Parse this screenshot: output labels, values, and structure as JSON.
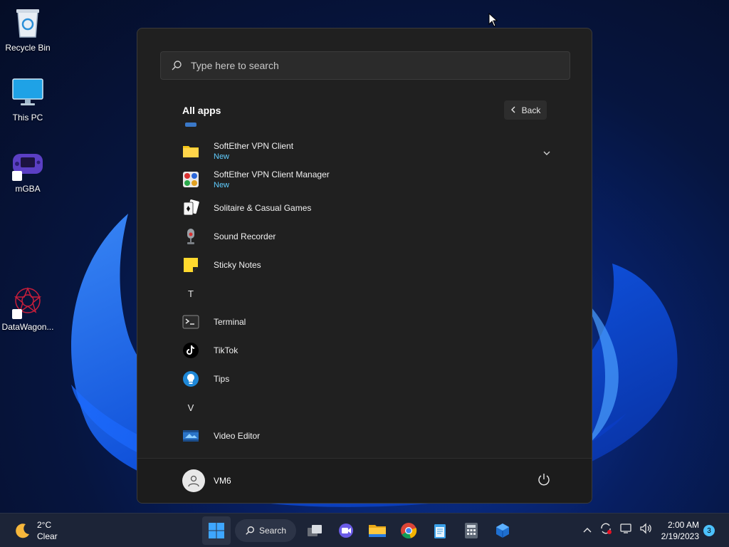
{
  "desktop": {
    "icons": [
      {
        "label": "Recycle Bin"
      },
      {
        "label": "This PC"
      },
      {
        "label": "mGBA"
      },
      {
        "label": "DataWagon..."
      }
    ]
  },
  "start_menu": {
    "search_placeholder": "Type here to search",
    "all_apps_title": "All apps",
    "back_label": "Back",
    "apps": [
      {
        "name": "SoftEther VPN Client",
        "badge": "New"
      },
      {
        "name": "SoftEther VPN Client Manager",
        "badge": "New"
      },
      {
        "name": "Solitaire & Casual Games"
      },
      {
        "name": "Sound Recorder"
      },
      {
        "name": "Sticky Notes"
      },
      {
        "letter": "T"
      },
      {
        "name": "Terminal"
      },
      {
        "name": "TikTok"
      },
      {
        "name": "Tips"
      },
      {
        "letter": "V"
      },
      {
        "name": "Video Editor"
      }
    ],
    "user_name": "VM6"
  },
  "taskbar": {
    "weather_temp": "2°C",
    "weather_desc": "Clear",
    "search_label": "Search",
    "time": "2:00 AM",
    "date": "2/19/2023",
    "notification_count": "3",
    "accent": "#4cc2ff"
  }
}
